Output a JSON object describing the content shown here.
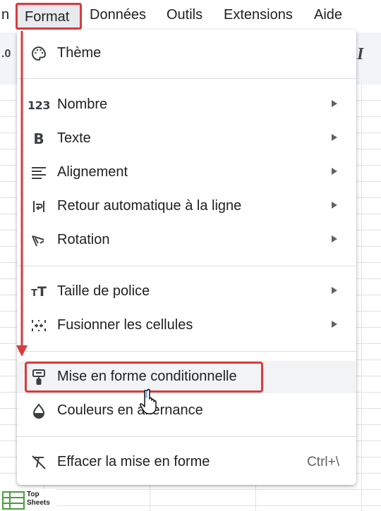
{
  "menubar": {
    "partial": "n",
    "items": [
      "Format",
      "Données",
      "Outils",
      "Extensions",
      "Aide"
    ]
  },
  "toolbar": {
    "left_partial": ".0",
    "right_italic": "I"
  },
  "menu": {
    "items": [
      {
        "label": "Thème",
        "icon": "palette-icon",
        "submenu": false
      },
      {
        "label": "Nombre",
        "icon": "number-123-icon",
        "submenu": true
      },
      {
        "label": "Texte",
        "icon": "bold-icon",
        "submenu": true
      },
      {
        "label": "Alignement",
        "icon": "align-left-icon",
        "submenu": true
      },
      {
        "label": "Retour automatique à la ligne",
        "icon": "text-wrap-icon",
        "submenu": true
      },
      {
        "label": "Rotation",
        "icon": "text-rotation-icon",
        "submenu": true
      },
      {
        "label": "Taille de police",
        "icon": "font-size-icon",
        "submenu": true
      },
      {
        "label": "Fusionner les cellules",
        "icon": "merge-cells-icon",
        "submenu": true
      },
      {
        "label": "Mise en forme conditionnelle",
        "icon": "paint-roller-icon",
        "submenu": false,
        "highlighted": true
      },
      {
        "label": "Couleurs en alternance",
        "icon": "color-drop-icon",
        "submenu": false
      },
      {
        "label": "Effacer la mise en forme",
        "icon": "clear-format-icon",
        "submenu": false,
        "shortcut": "Ctrl+\\"
      }
    ]
  },
  "logo": {
    "line1": "Top",
    "line2": "Sheets"
  },
  "colors": {
    "highlight_border": "#d93b3f",
    "menu_bg": "#ffffff",
    "toolbar_bg": "#f1f4f9",
    "hover_bg": "#f1f3f4"
  }
}
